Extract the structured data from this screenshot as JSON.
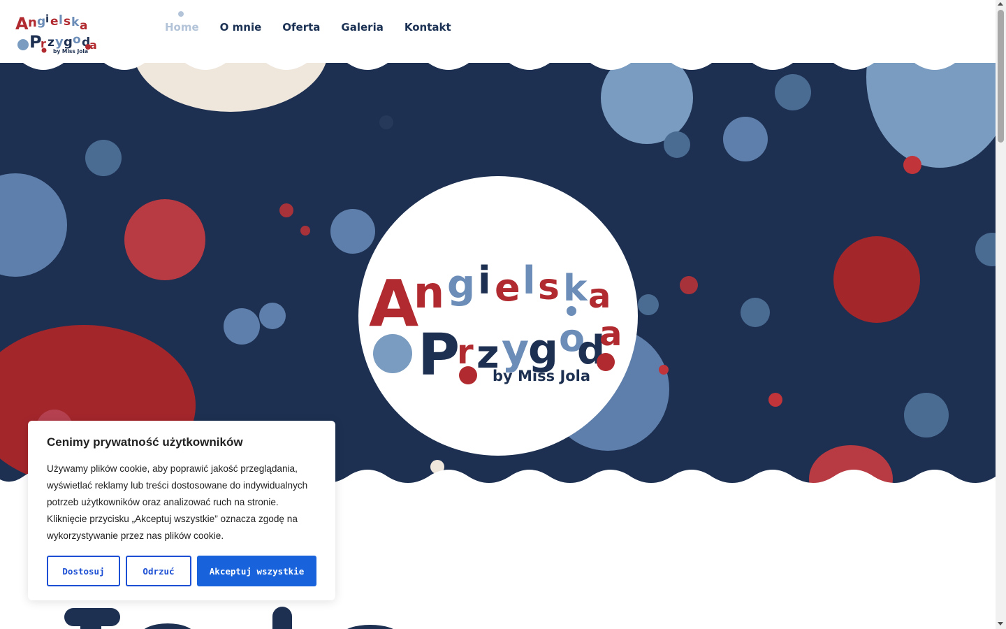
{
  "logo": {
    "line1": "Angielska",
    "line2": "Przygoda",
    "line3": "by Miss Jola"
  },
  "nav": {
    "items": [
      {
        "label": "Home"
      },
      {
        "label": "O mnie"
      },
      {
        "label": "Oferta"
      },
      {
        "label": "Galeria"
      },
      {
        "label": "Kontakt"
      }
    ]
  },
  "cookie_banner": {
    "title": "Cenimy prywatność użytkowników",
    "text": "Używamy plików cookie, aby poprawić jakość przeglądania, wyświetlać reklamy lub treści dostosowane do indywidualnych potrzeb użytkowników oraz analizować ruch na stronie. Kliknięcie przycisku „Akceptuj wszystkie” oznacza zgodę na wykorzystywanie przez nas plików cookie.",
    "customize_label": "Dostosuj",
    "reject_label": "Odrzuć",
    "accept_label": "Akceptuj wszystkie"
  },
  "colors": {
    "navy": "#1d3051",
    "red": "#b02a2f",
    "light_blue": "#7a9cc0",
    "accent_blue": "#1863dc",
    "cream": "#efe6dc"
  },
  "icons": [
    "scroll-up-arrow-icon",
    "scroll-down-arrow-icon",
    "nav-active-dot-icon"
  ]
}
